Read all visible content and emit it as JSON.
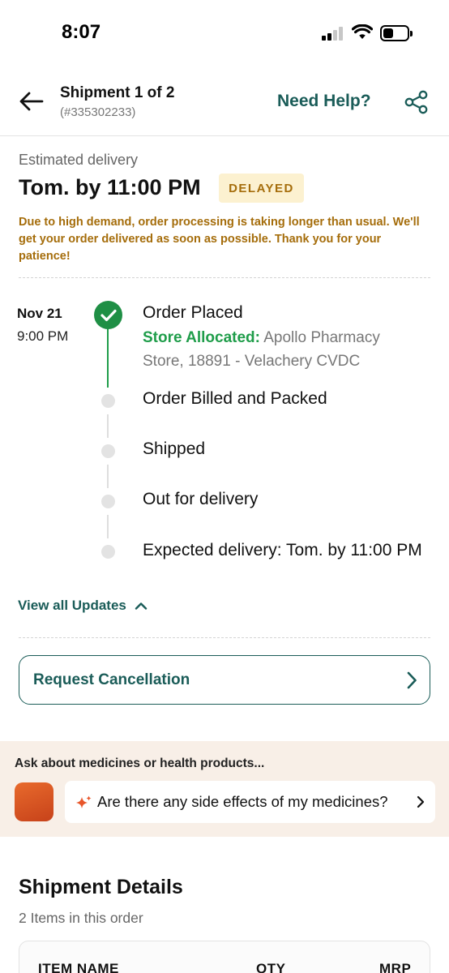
{
  "status_bar": {
    "time": "8:07"
  },
  "header": {
    "title": "Shipment 1 of 2",
    "subtitle": "(#335302233)",
    "help_label": "Need Help?"
  },
  "delivery": {
    "label": "Estimated delivery",
    "value": "Tom. by 11:00 PM",
    "badge": "DELAYED",
    "message": "Due to high demand, order processing is taking longer than usual. We'll get your order delivered as soon as possible. Thank you for your patience!"
  },
  "timeline": {
    "date": "Nov 21",
    "time": "9:00 PM",
    "steps": [
      {
        "label": "Order Placed",
        "status": "done"
      },
      {
        "label": "Order Billed and Packed",
        "status": "pending"
      },
      {
        "label": "Shipped",
        "status": "pending"
      },
      {
        "label": "Out for delivery",
        "status": "pending"
      },
      {
        "label": "Expected delivery: Tom. by 11:00 PM",
        "status": "pending"
      }
    ],
    "store_label": "Store Allocated:",
    "store_value": "Apollo Pharmacy Store, 18891 - Velachery CVDC",
    "view_all": "View all Updates"
  },
  "cancel": {
    "label": "Request Cancellation"
  },
  "ask": {
    "label": "Ask about medicines or health products...",
    "question": "Are there any side effects of my medicines?"
  },
  "shipment_details": {
    "title": "Shipment Details",
    "subtitle": "2 Items in this order",
    "columns": [
      "ITEM NAME",
      "QTY",
      "MRP"
    ]
  },
  "colors": {
    "brand": "#1a5c58",
    "success": "#1f9d4a",
    "warning": "#a56d0b",
    "badge_bg": "#fcf1d0",
    "ask_bg": "#f8efe7"
  }
}
